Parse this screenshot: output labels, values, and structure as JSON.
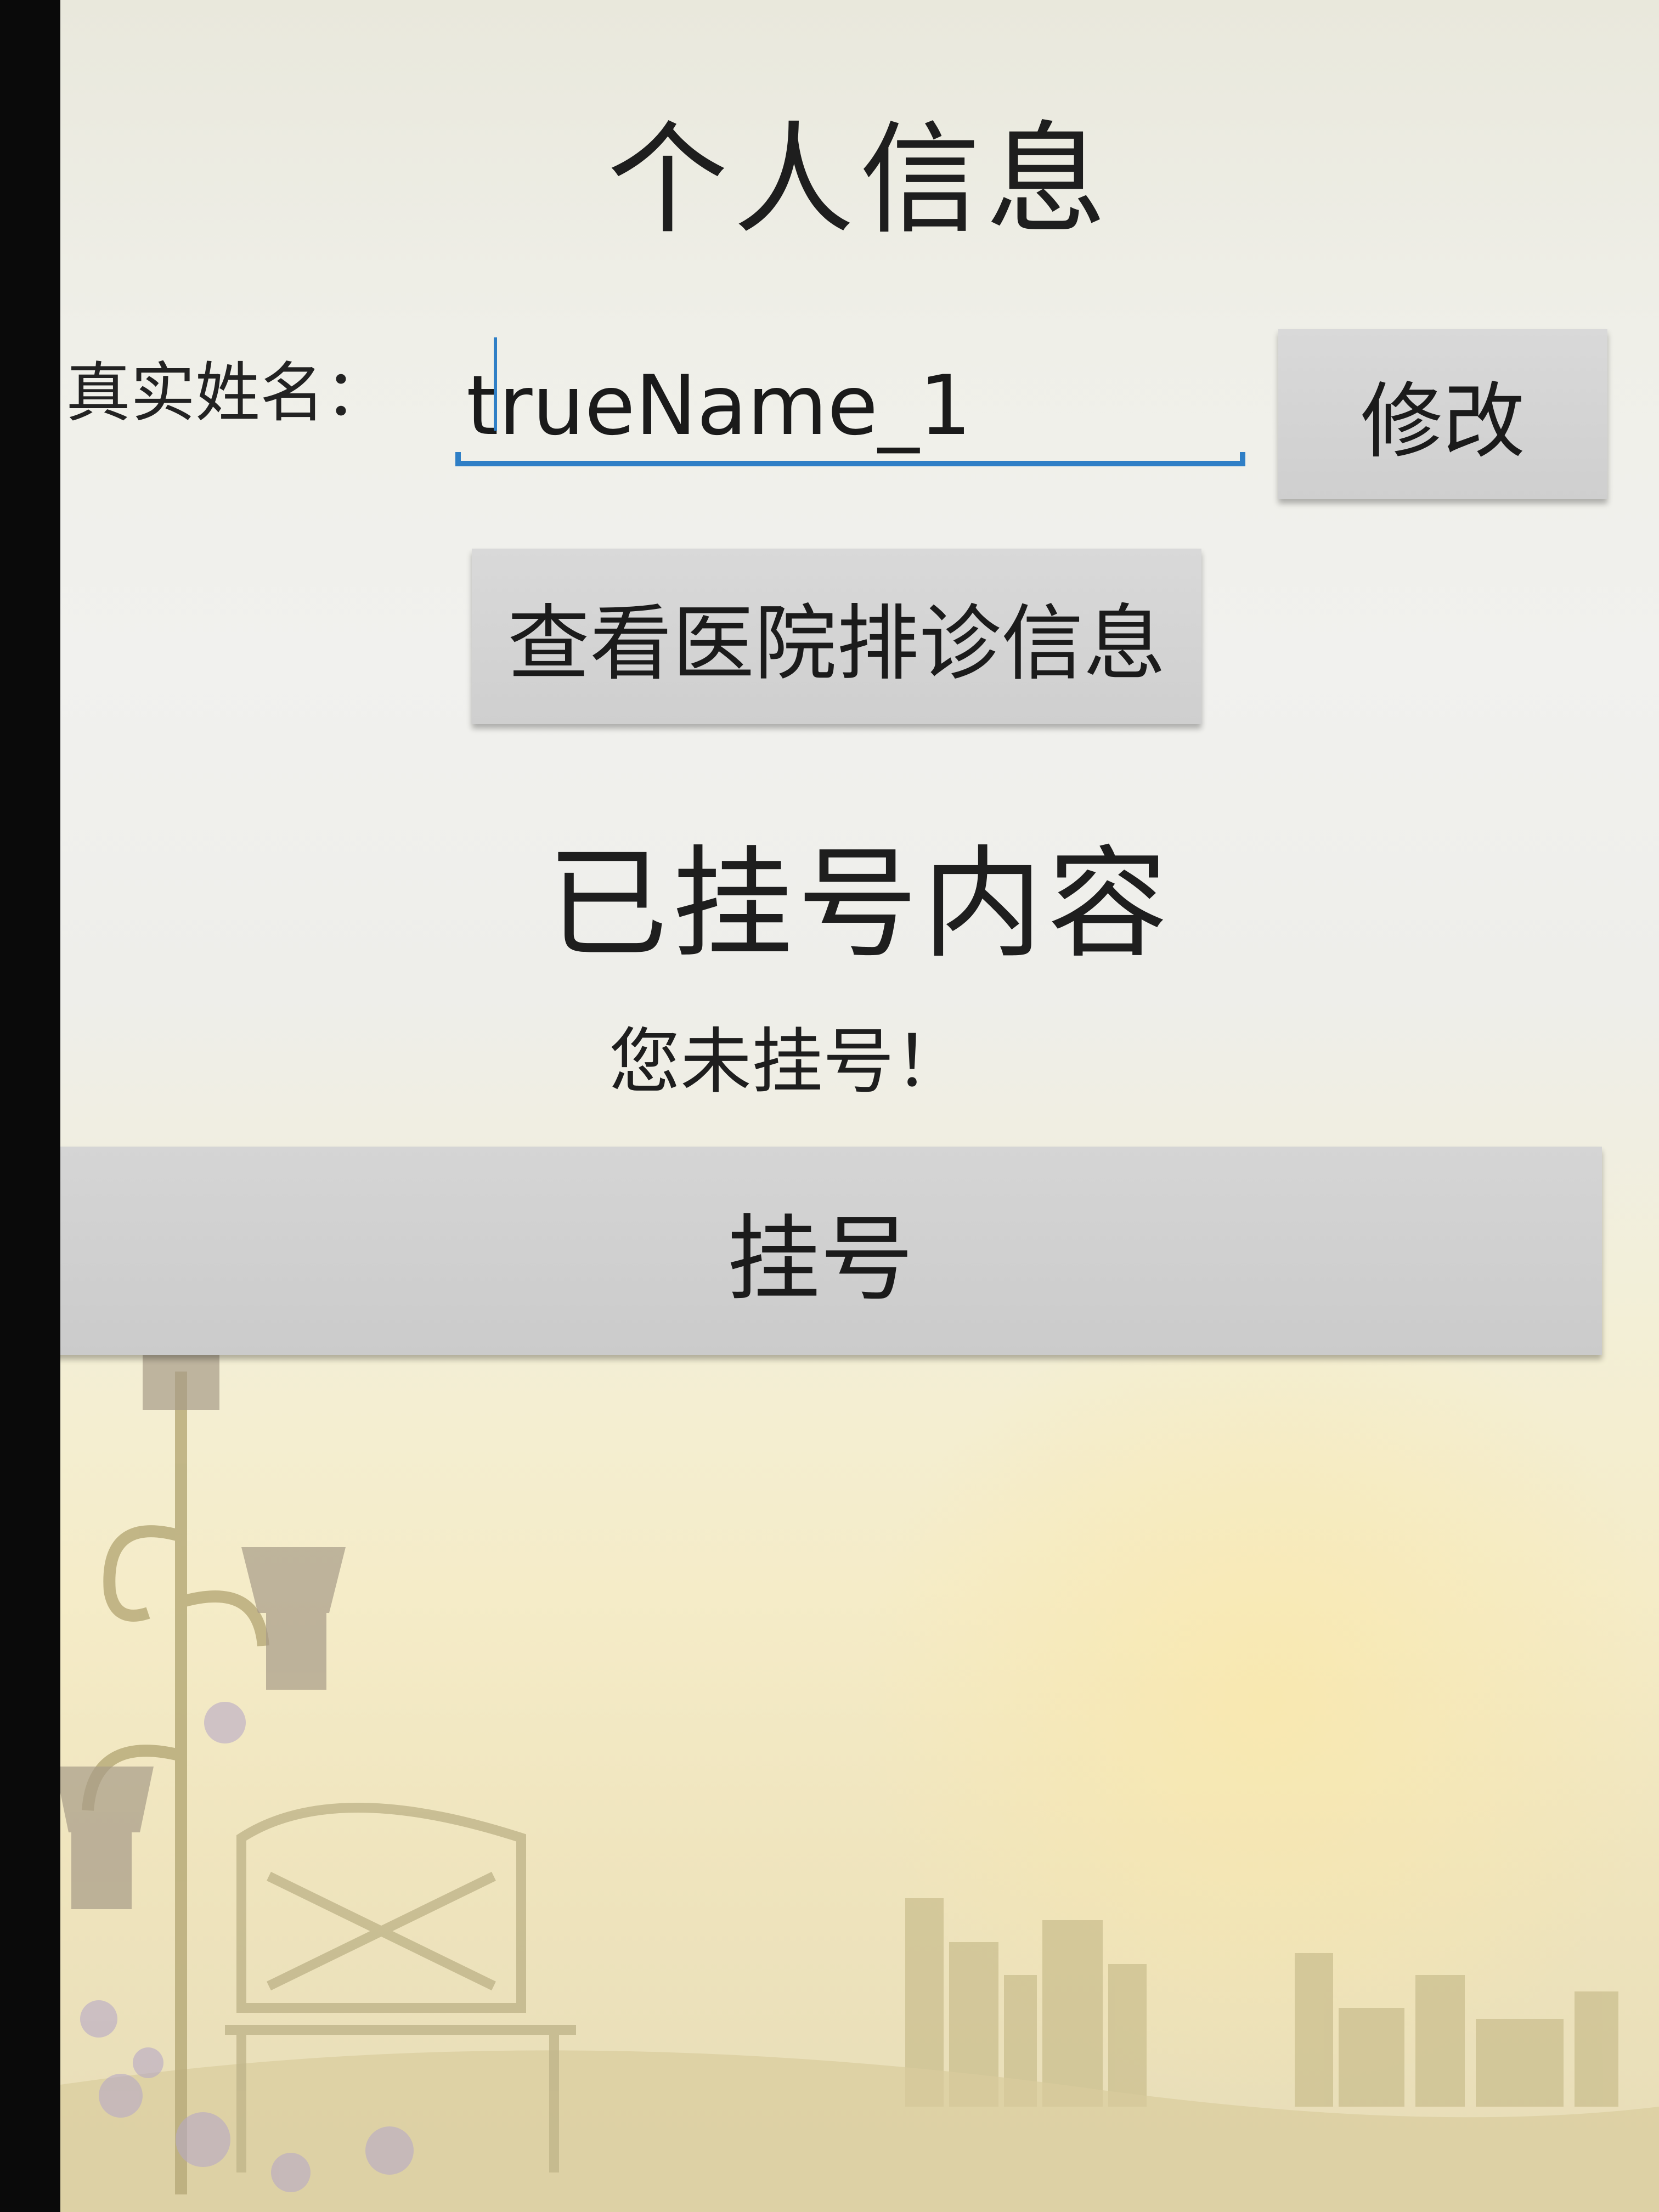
{
  "header": {
    "title": "个人信息"
  },
  "profile": {
    "name_label": "真实姓名：",
    "name_value": "trueName_1",
    "modify_label": "修改"
  },
  "schedule_button": "查看医院排诊信息",
  "registration": {
    "section_title": "已挂号内容",
    "status": "您未挂号！",
    "register_label": "挂号"
  },
  "colors": {
    "input_underline": "#2f7fc6",
    "button_bg": "#d3d3d3"
  }
}
